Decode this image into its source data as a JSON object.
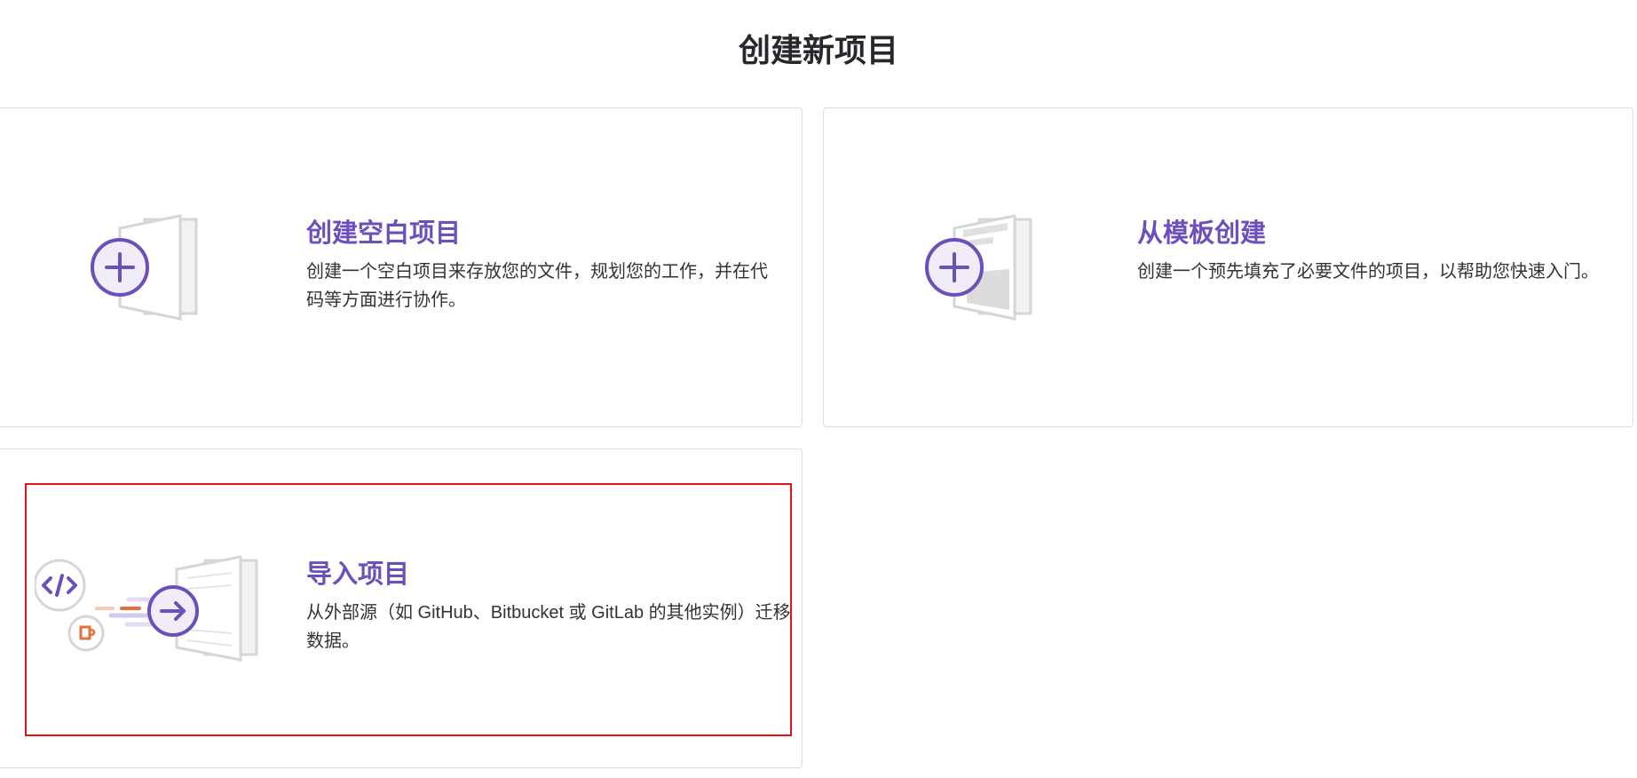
{
  "page": {
    "title": "创建新项目"
  },
  "cards": {
    "blank": {
      "title": "创建空白项目",
      "description": "创建一个空白项目来存放您的文件，规划您的工作，并在代码等方面进行协作。"
    },
    "template": {
      "title": "从模板创建",
      "description": "创建一个预先填充了必要文件的项目，以帮助您快速入门。"
    },
    "import": {
      "title": "导入项目",
      "description": "从外部源（如 GitHub、Bitbucket 或 GitLab 的其他实例）迁移数据。"
    }
  },
  "icons": {
    "blank": "plus-document-icon",
    "template": "template-document-icon",
    "import": "import-arrow-icon"
  },
  "colors": {
    "accent": "#6b4fbb",
    "title": "#28272d",
    "border": "#dcdcde",
    "highlight": "#e3121b",
    "orange": "#e9703a"
  }
}
